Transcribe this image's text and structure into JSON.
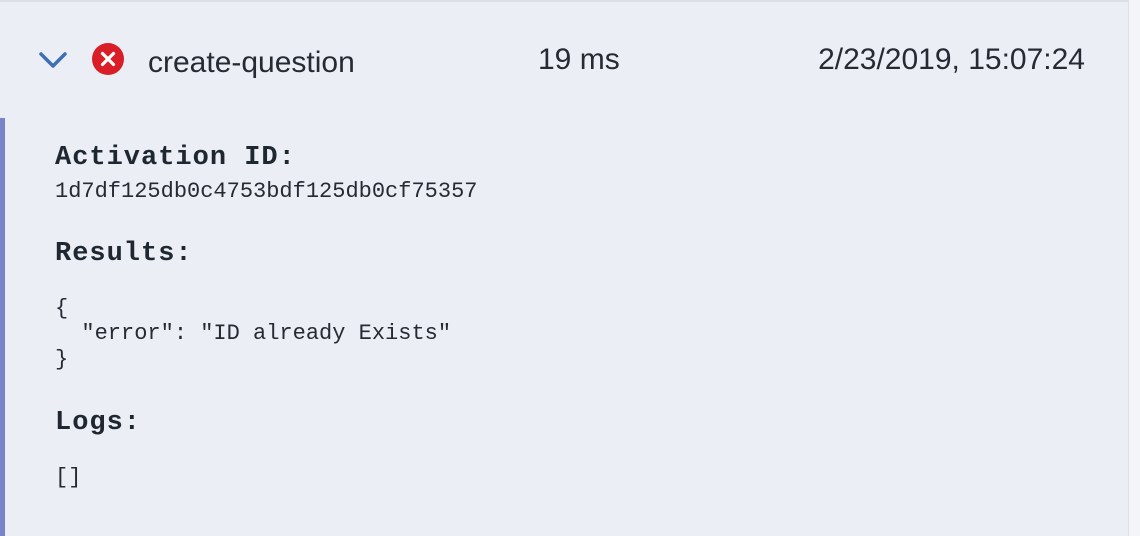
{
  "activation": {
    "name": "create-question",
    "duration": "19 ms",
    "timestamp": "2/23/2019, 15:07:24",
    "status": "error",
    "status_color": "#da1e28",
    "accent_color": "#7b83c8",
    "expanded": true
  },
  "details": {
    "activation_id_label": "Activation ID:",
    "activation_id": "1d7df125db0c4753bdf125db0cf75357",
    "results_label": "Results:",
    "results_lines": [
      "{",
      "  \"error\": \"ID already Exists\"",
      "}"
    ],
    "logs_label": "Logs:",
    "logs_value": "[]"
  },
  "icons": {
    "expand": "chevron-down-icon",
    "status": "error-circle-icon"
  }
}
